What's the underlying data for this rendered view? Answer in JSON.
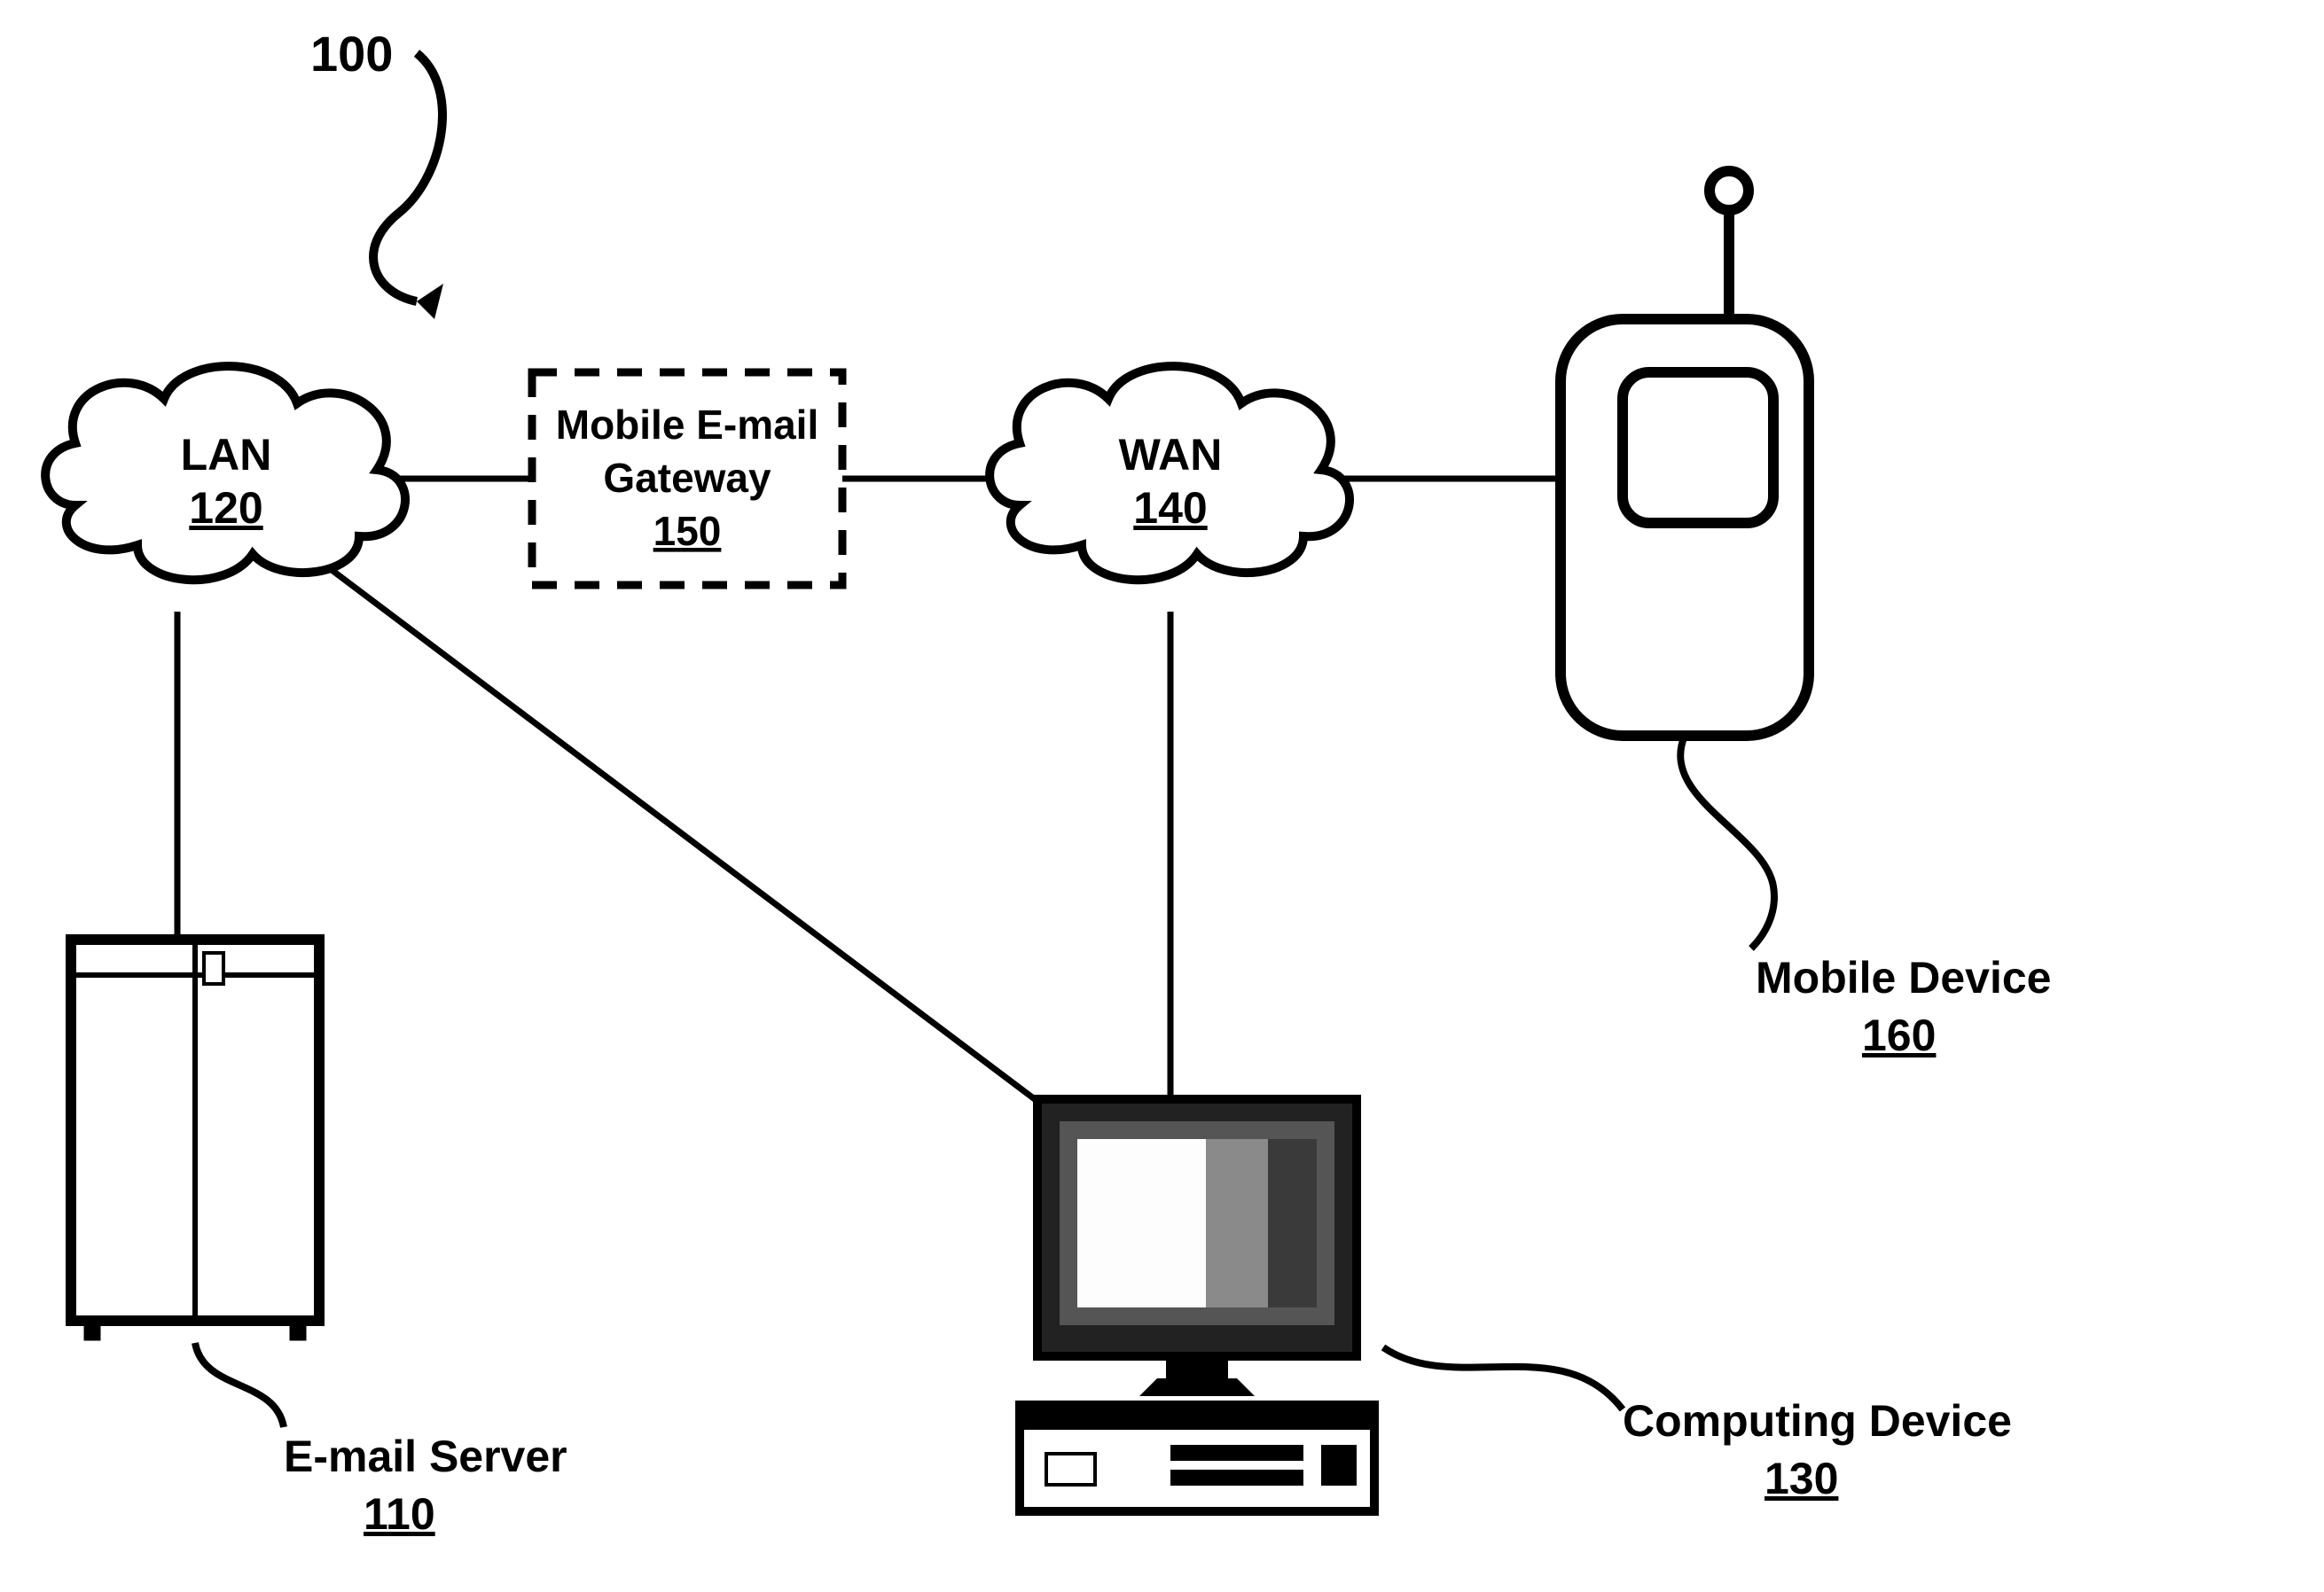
{
  "figure_ref": "100",
  "nodes": {
    "lan": {
      "label": "LAN",
      "ref": "120"
    },
    "gateway": {
      "label": "Mobile E-mail Gateway",
      "ref": "150"
    },
    "wan": {
      "label": "WAN",
      "ref": "140"
    },
    "mobile": {
      "label": "Mobile Device",
      "ref": "160"
    },
    "server": {
      "label": "E-mail Server",
      "ref": "110"
    },
    "computer": {
      "label": "Computing Device",
      "ref": "130"
    }
  }
}
